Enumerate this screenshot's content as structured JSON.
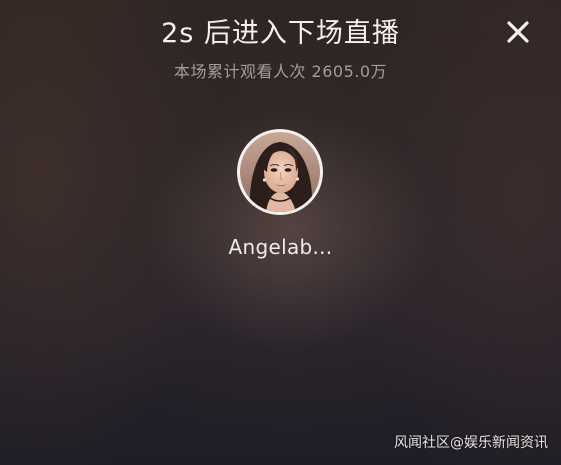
{
  "countdown": {
    "title": "2s 后进入下场直播",
    "view_count_text": "本场累计观看人次 2605.0万"
  },
  "close": {
    "icon": "close-icon"
  },
  "streamer": {
    "name": "Angelab...",
    "avatar_icon": "avatar"
  },
  "watermark": {
    "text": "风闻社区@娱乐新闻资讯"
  },
  "colors": {
    "title_text": "#f4f1ee",
    "subtitle_text": "#a39c98",
    "avatar_ring": "#f3efec"
  }
}
